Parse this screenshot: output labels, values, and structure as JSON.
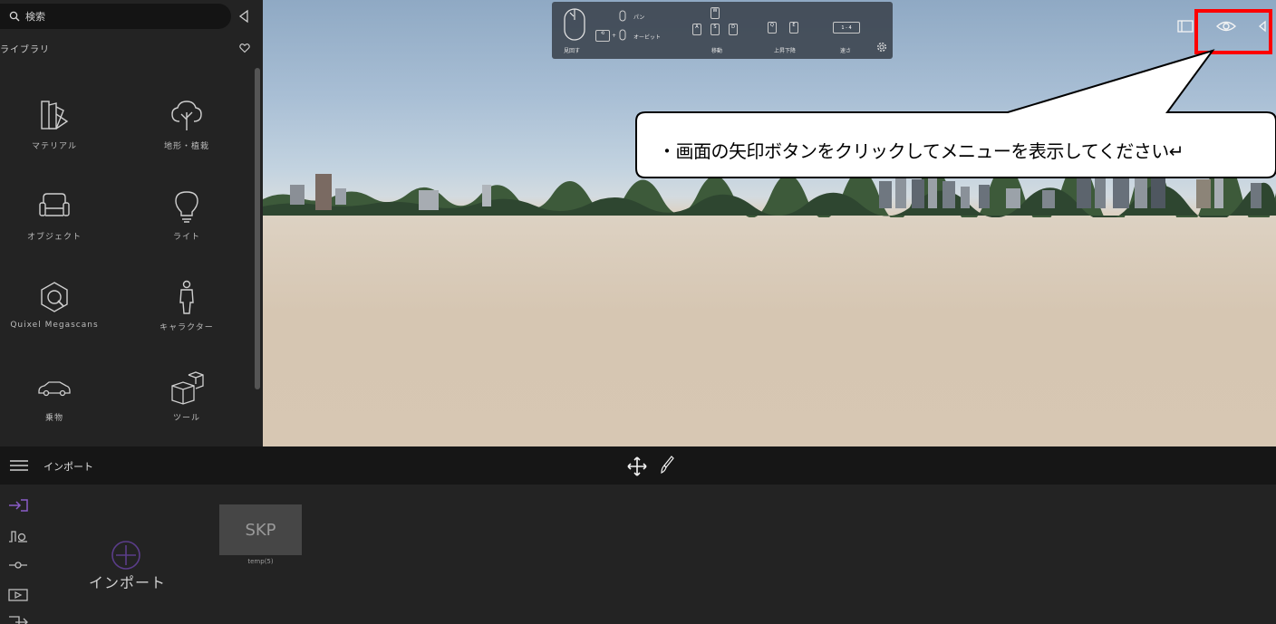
{
  "library": {
    "search_placeholder": "検索",
    "title": "ライブラリ",
    "categories": [
      {
        "label": "マテリアル",
        "icon": "material-swatch-icon"
      },
      {
        "label": "地形・植栽",
        "icon": "tree-icon"
      },
      {
        "label": "オブジェクト",
        "icon": "sofa-icon"
      },
      {
        "label": "ライト",
        "icon": "lightbulb-icon"
      },
      {
        "label": "Quixel Megascans",
        "icon": "megascans-icon"
      },
      {
        "label": "キャラクター",
        "icon": "person-icon"
      },
      {
        "label": "乗物",
        "icon": "car-icon"
      },
      {
        "label": "ツール",
        "icon": "cubes-icon"
      }
    ]
  },
  "nav_controls": {
    "look": "見回す",
    "pan": "パン",
    "orbit": "オービット",
    "move": "移動",
    "updown": "上昇下降",
    "speed": "速さ",
    "keys": {
      "w": "W",
      "a": "A",
      "s": "S",
      "d": "D",
      "q": "Q",
      "e": "E",
      "speed_range": "1 - 4"
    }
  },
  "callout": {
    "text": "・画面の矢印ボタンをクリックしてメニューを表示してください↵"
  },
  "bottom": {
    "title": "インポート",
    "import_label": "インポート",
    "files": [
      {
        "thumb": "SKP",
        "name": "temp(5)"
      }
    ]
  },
  "colors": {
    "accent_purple": "#8a5cc8",
    "highlight_red": "#ff0000"
  }
}
